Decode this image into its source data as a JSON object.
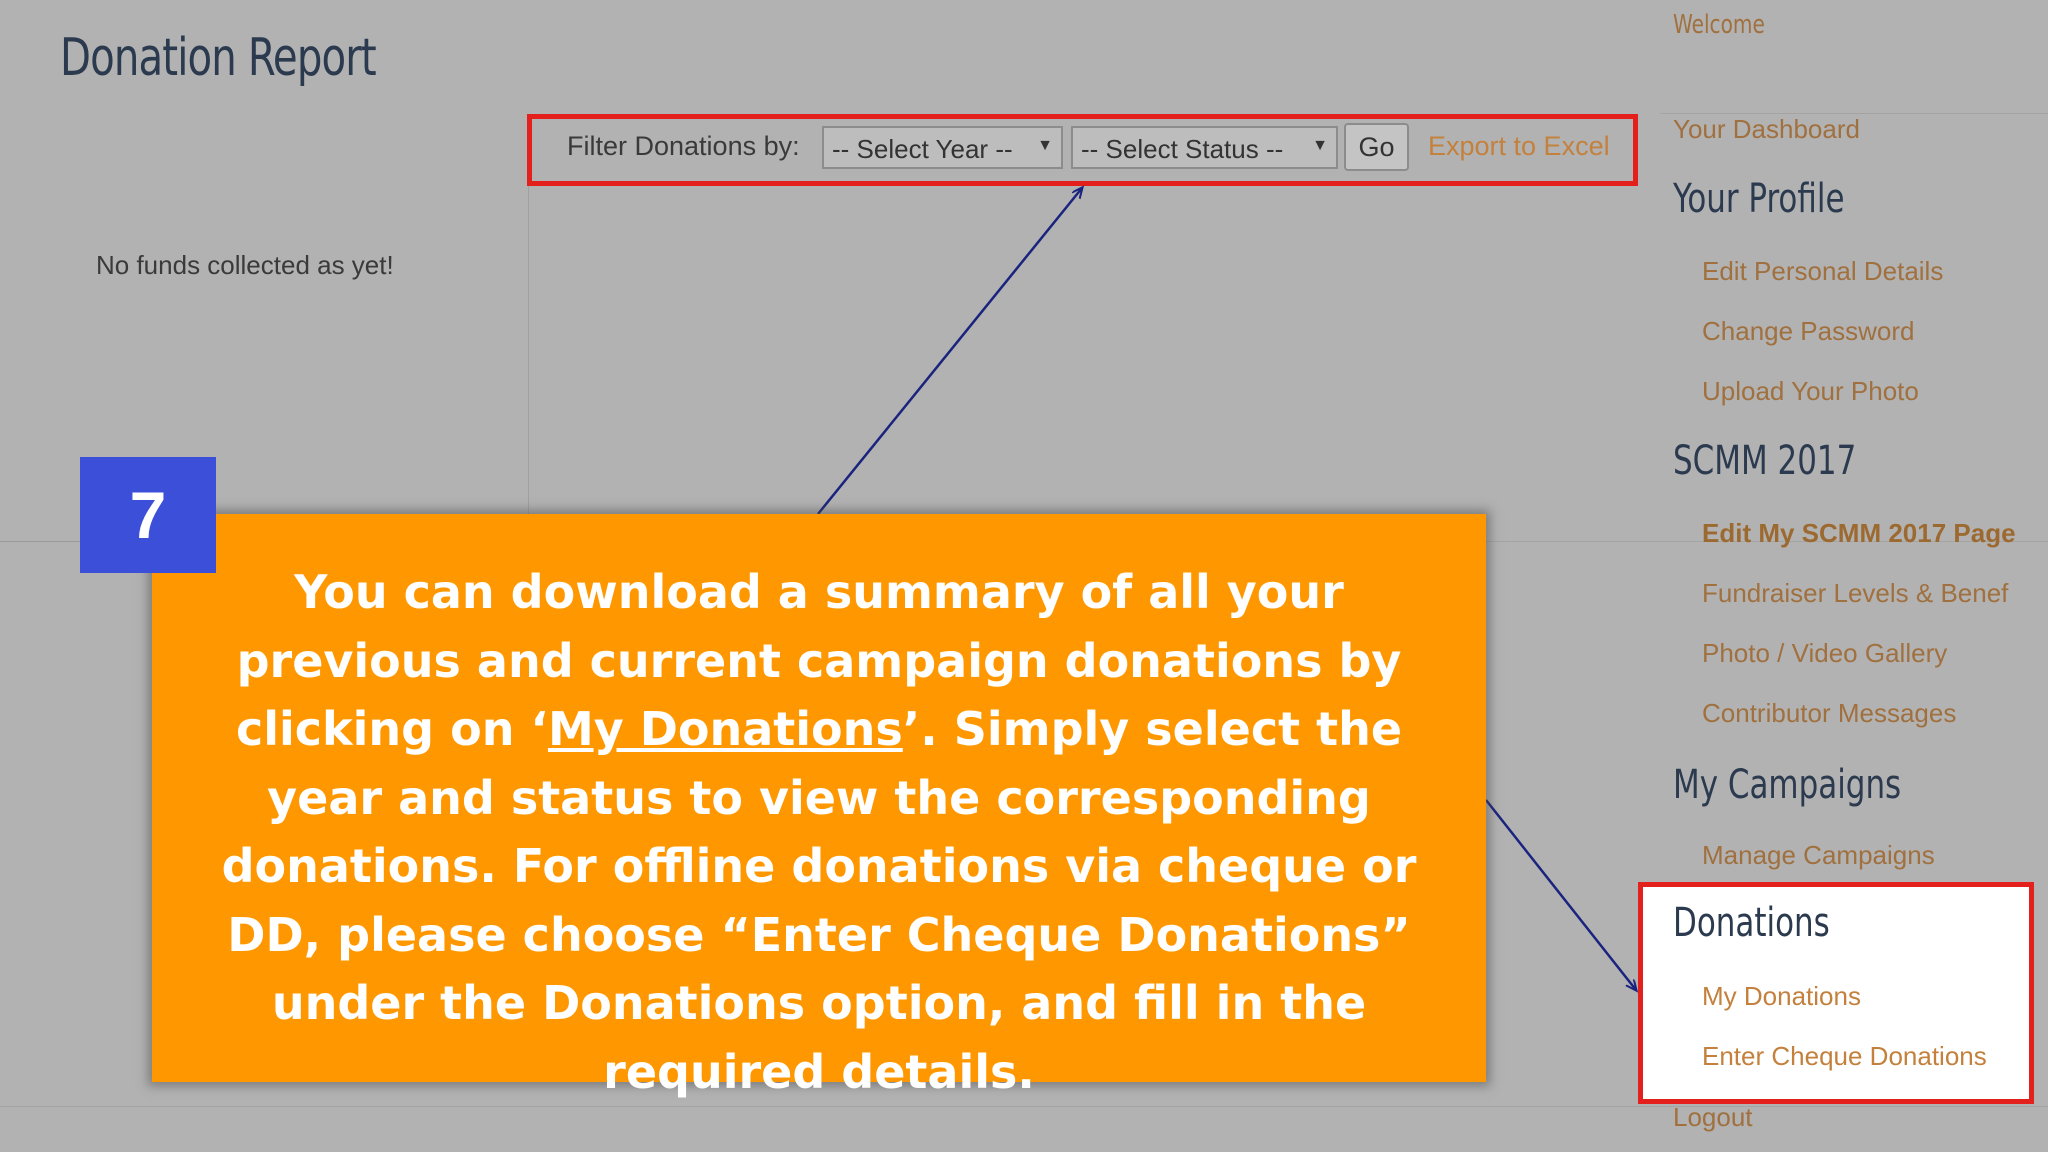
{
  "page": {
    "title": "Donation Report",
    "no_funds_text": "No funds collected as yet!"
  },
  "filter": {
    "label": "Filter Donations by:",
    "year_select": "-- Select Year --",
    "status_select": "-- Select Status --",
    "go_label": "Go",
    "export_label": "Export to Excel"
  },
  "sidebar": {
    "welcome": "Welcome",
    "dashboard": "Your Dashboard",
    "profile": {
      "heading": "Your Profile",
      "items": [
        "Edit Personal Details",
        "Change Password",
        "Upload Your Photo"
      ]
    },
    "scmm": {
      "heading": "SCMM 2017",
      "items": [
        "Edit My SCMM 2017 Page",
        "Fundraiser Levels & Benef",
        "Photo / Video Gallery",
        "Contributor Messages"
      ]
    },
    "campaigns": {
      "heading": "My Campaigns",
      "items": [
        "Manage Campaigns"
      ]
    },
    "donations": {
      "heading": "Donations",
      "items": [
        "My Donations",
        "Enter Cheque Donations"
      ]
    },
    "logout": "Logout"
  },
  "callout": {
    "step": "7",
    "text_before": "You can download a summary of all your previous and current campaign donations by clicking on ‘",
    "link_text": "My Donations",
    "text_after": "’. Simply select the year and status to view the corresponding donations. For offline donations via cheque or DD, please choose “Enter Cheque Donations” under the Donations option, and fill in the required details."
  },
  "colors": {
    "background": "#b2b2b2",
    "highlight_border": "#e3201b",
    "callout_bg": "#ff9800",
    "badge_bg": "#3b4fd9",
    "link": "#c4813d",
    "heading": "#2b3a4e",
    "arrow": "#1a237e"
  }
}
